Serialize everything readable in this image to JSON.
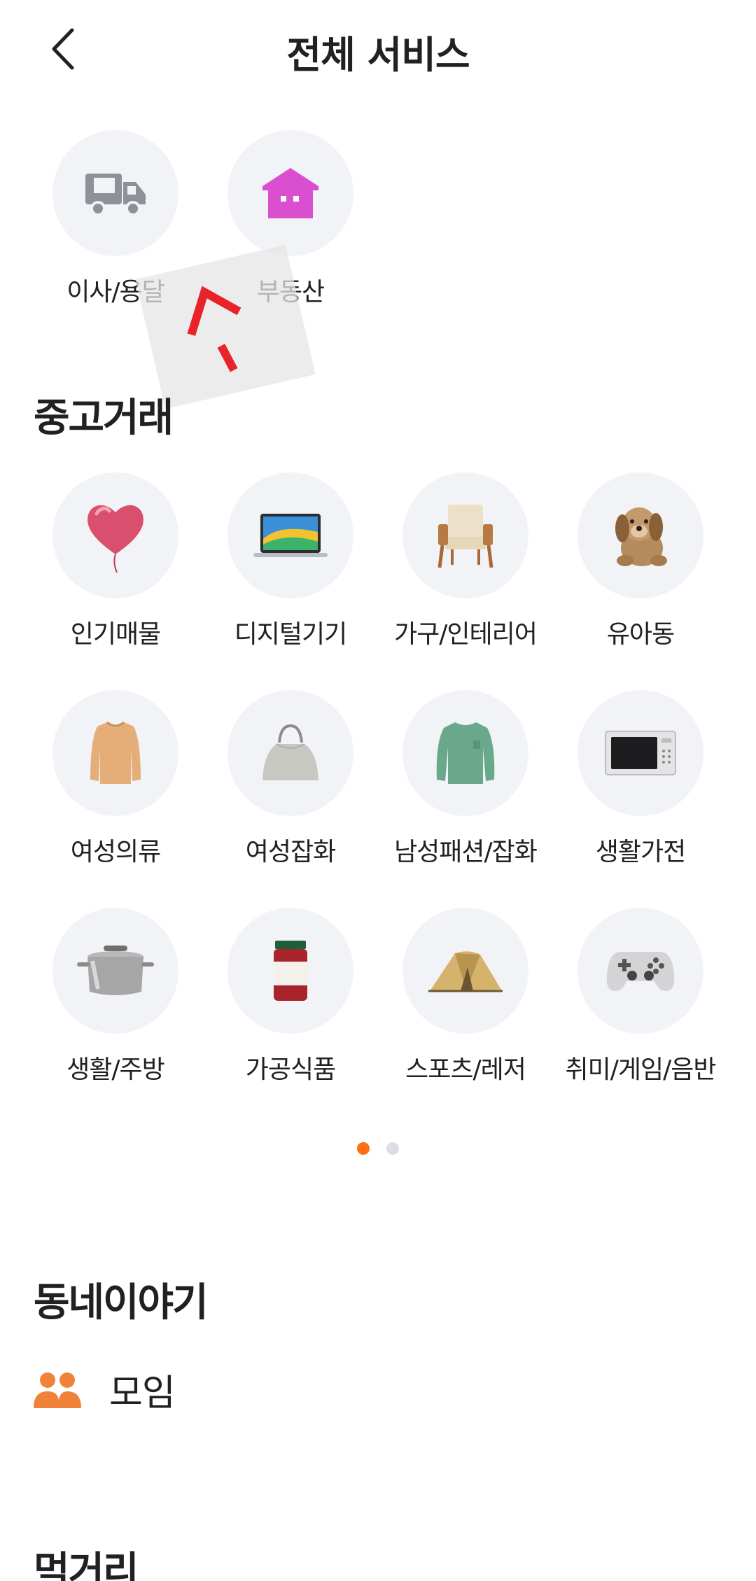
{
  "header": {
    "title": "전체 서비스",
    "back_icon": "chevron-left-icon"
  },
  "top_services": [
    {
      "label": "이사/용달",
      "icon": "truck-icon"
    },
    {
      "label": "부동산",
      "icon": "house-icon"
    }
  ],
  "used_trade": {
    "title": "중고거래",
    "categories": [
      {
        "label": "인기매물",
        "icon": "heart-balloon-icon"
      },
      {
        "label": "디지털기기",
        "icon": "laptop-icon"
      },
      {
        "label": "가구/인테리어",
        "icon": "armchair-icon"
      },
      {
        "label": "유아동",
        "icon": "teddy-dog-icon"
      },
      {
        "label": "여성의류",
        "icon": "sweater-icon"
      },
      {
        "label": "여성잡화",
        "icon": "handbag-icon"
      },
      {
        "label": "남성패션/잡화",
        "icon": "green-sweater-icon"
      },
      {
        "label": "생활가전",
        "icon": "microwave-icon"
      },
      {
        "label": "생활/주방",
        "icon": "pot-icon"
      },
      {
        "label": "가공식품",
        "icon": "jar-icon"
      },
      {
        "label": "스포츠/레저",
        "icon": "tent-icon"
      },
      {
        "label": "취미/게임/음반",
        "icon": "gamepad-icon"
      }
    ],
    "page_count": 2,
    "active_page": 1
  },
  "neighborhood": {
    "title": "동네이야기",
    "items": [
      {
        "label": "모임",
        "icon": "people-icon"
      }
    ]
  },
  "food": {
    "title": "먹거리"
  },
  "colors": {
    "accent": "#ff6f0f",
    "circle_bg": "#f2f3f6",
    "text": "#212124",
    "truck": "#8e9199",
    "house": "#d94fd0"
  }
}
